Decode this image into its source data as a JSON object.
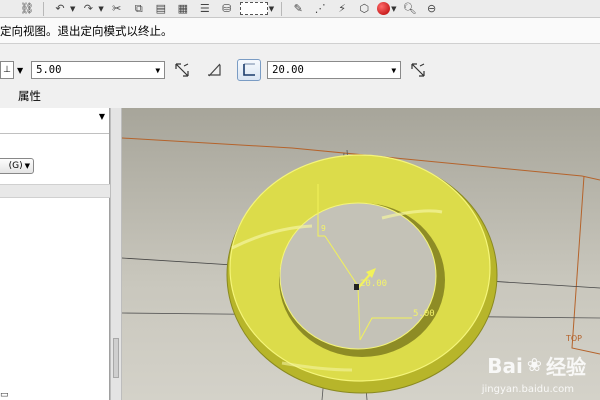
{
  "toolbar": {
    "icons": [
      "link-icon",
      "undo-icon",
      "redo-icon",
      "cut-icon",
      "copy-icon",
      "paste-icon",
      "table-icon",
      "align-icon",
      "binoculars-icon",
      "selection-frame-icon",
      "sketch-icon",
      "datum-point-icon",
      "analysis-icon",
      "view-icon",
      "render-sphere-icon",
      "zoom-icon",
      "zoom-out-icon"
    ]
  },
  "message": "定向视图。退出定向模式以终止。",
  "dashboard": {
    "thickness_value": "5.00",
    "offset_value": "20.00"
  },
  "tabs": {
    "properties": "属性"
  },
  "left_panel": {
    "button_label": "(G)",
    "edge_mark": "▭"
  },
  "viewport": {
    "dim_a": "20.00",
    "dim_b": "5.00",
    "dim_c": "9",
    "plane_label": "TOP",
    "accent": "#e8e83a",
    "edge_color": "#9a9a2a",
    "plane_color": "#b5632b"
  },
  "watermark": {
    "brand": "Bai",
    "brand2": "经验",
    "url": "jingyan.baidu.com"
  }
}
